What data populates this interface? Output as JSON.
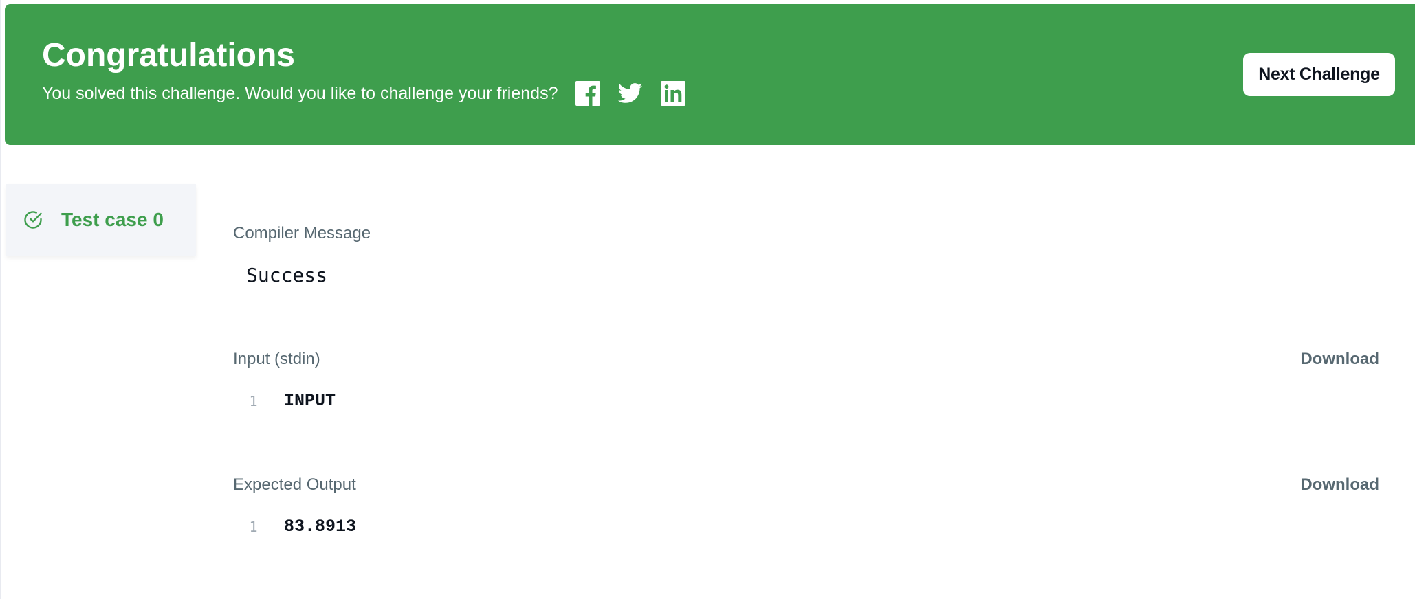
{
  "banner": {
    "title": "Congratulations",
    "subtitle": "You solved this challenge. Would you like to challenge your friends?",
    "share_icons": [
      "facebook-icon",
      "twitter-icon",
      "linkedin-icon"
    ],
    "next_label": "Next Challenge",
    "color": "#3e9e4d"
  },
  "sidebar": {
    "tab_label": "Test case 0",
    "status_icon": "check-circle-icon",
    "status": "passed"
  },
  "main": {
    "compiler": {
      "label": "Compiler Message",
      "message": "Success"
    },
    "input": {
      "label": "Input (stdin)",
      "download_label": "Download",
      "lines": [
        {
          "num": "1",
          "text": "INPUT"
        }
      ]
    },
    "expected": {
      "label": "Expected Output",
      "download_label": "Download",
      "lines": [
        {
          "num": "1",
          "text": "83.8913"
        }
      ]
    }
  },
  "colors": {
    "success_green": "#3e9e4d",
    "label_gray": "#576871",
    "text_dark": "#0e141e"
  }
}
